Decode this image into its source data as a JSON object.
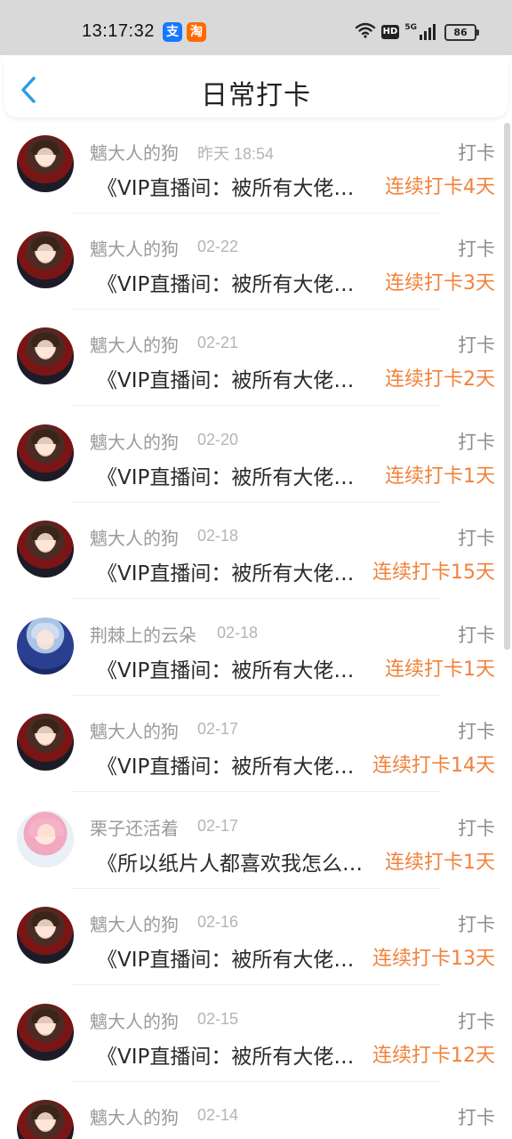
{
  "status_bar": {
    "time": "13:17:32",
    "app_icons": [
      {
        "name": "alipay-icon",
        "glyph": "支",
        "color": "#1677ff"
      },
      {
        "name": "taobao-icon",
        "glyph": "淘",
        "color": "#ff6a00"
      }
    ],
    "hd": "HD",
    "network": "5G",
    "battery": "86"
  },
  "header": {
    "title": "日常打卡",
    "back_icon": "chevron-left-icon",
    "accent_color": "#2b9be6"
  },
  "items": [
    {
      "user": "魑大人的狗",
      "time": "昨天 18:54",
      "type": "打卡",
      "book": "《VIP直播间：被所有大佬…",
      "streak": "连续打卡4天",
      "avatar": "dog"
    },
    {
      "user": "魑大人的狗",
      "time": "02-22",
      "type": "打卡",
      "book": "《VIP直播间：被所有大佬…",
      "streak": "连续打卡3天",
      "avatar": "dog"
    },
    {
      "user": "魑大人的狗",
      "time": "02-21",
      "type": "打卡",
      "book": "《VIP直播间：被所有大佬…",
      "streak": "连续打卡2天",
      "avatar": "dog"
    },
    {
      "user": "魑大人的狗",
      "time": "02-20",
      "type": "打卡",
      "book": "《VIP直播间：被所有大佬…",
      "streak": "连续打卡1天",
      "avatar": "dog"
    },
    {
      "user": "魑大人的狗",
      "time": "02-18",
      "type": "打卡",
      "book": "《VIP直播间：被所有大佬…",
      "streak": "连续打卡15天",
      "avatar": "dog"
    },
    {
      "user": "荆棘上的云朵",
      "time": "02-18",
      "type": "打卡",
      "book": "《VIP直播间：被所有大佬…",
      "streak": "连续打卡1天",
      "avatar": "blue"
    },
    {
      "user": "魑大人的狗",
      "time": "02-17",
      "type": "打卡",
      "book": "《VIP直播间：被所有大佬…",
      "streak": "连续打卡14天",
      "avatar": "dog"
    },
    {
      "user": "栗子还活着",
      "time": "02-17",
      "type": "打卡",
      "book": "《所以纸片人都喜欢我怎么…",
      "streak": "连续打卡1天",
      "avatar": "pink"
    },
    {
      "user": "魑大人的狗",
      "time": "02-16",
      "type": "打卡",
      "book": "《VIP直播间：被所有大佬…",
      "streak": "连续打卡13天",
      "avatar": "dog"
    },
    {
      "user": "魑大人的狗",
      "time": "02-15",
      "type": "打卡",
      "book": "《VIP直播间：被所有大佬…",
      "streak": "连续打卡12天",
      "avatar": "dog"
    },
    {
      "user": "魑大人的狗",
      "time": "02-14",
      "type": "打卡",
      "book": "",
      "streak": "",
      "avatar": "dog"
    }
  ],
  "colors": {
    "streak": "#f0823c",
    "username": "#9a9a9a",
    "title": "#2b2b2b"
  }
}
